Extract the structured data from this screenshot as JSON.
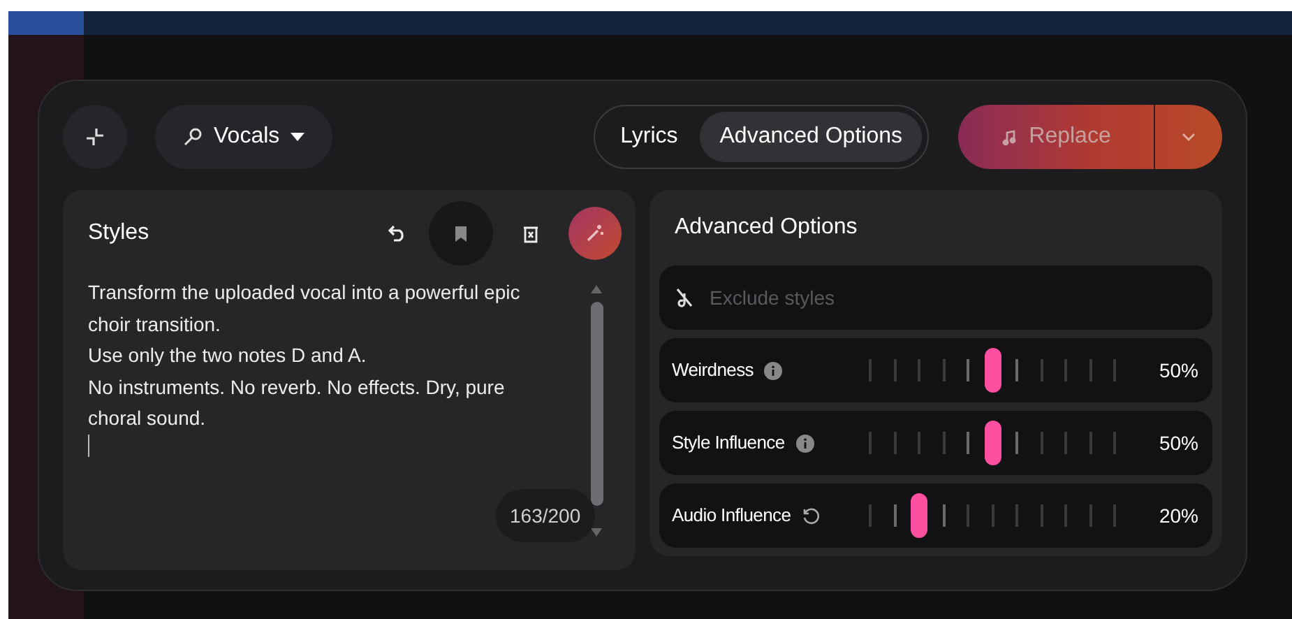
{
  "toolbar": {
    "instrument": "Vocals",
    "tabs": [
      {
        "label": "Lyrics",
        "selected": false
      },
      {
        "label": "Advanced Options",
        "selected": true
      }
    ],
    "action": "Replace"
  },
  "styles": {
    "title": "Styles",
    "value": "Transform the uploaded vocal into a powerful epic choir transition.\nUse only the two notes D and A.\nNo instruments. No reverb. No effects. Dry, pure choral sound.",
    "counter": "163/200"
  },
  "advanced": {
    "title": "Advanced Options",
    "exclude_placeholder": "Exclude styles",
    "sliders": [
      {
        "label": "Weirdness",
        "kind": "info",
        "level": 0.5,
        "reading": "50%"
      },
      {
        "label": "Style Influence",
        "kind": "info",
        "level": 0.5,
        "reading": "50%"
      },
      {
        "label": "Audio Influence",
        "kind": "reset",
        "level": 0.2,
        "reading": "20%"
      }
    ]
  }
}
